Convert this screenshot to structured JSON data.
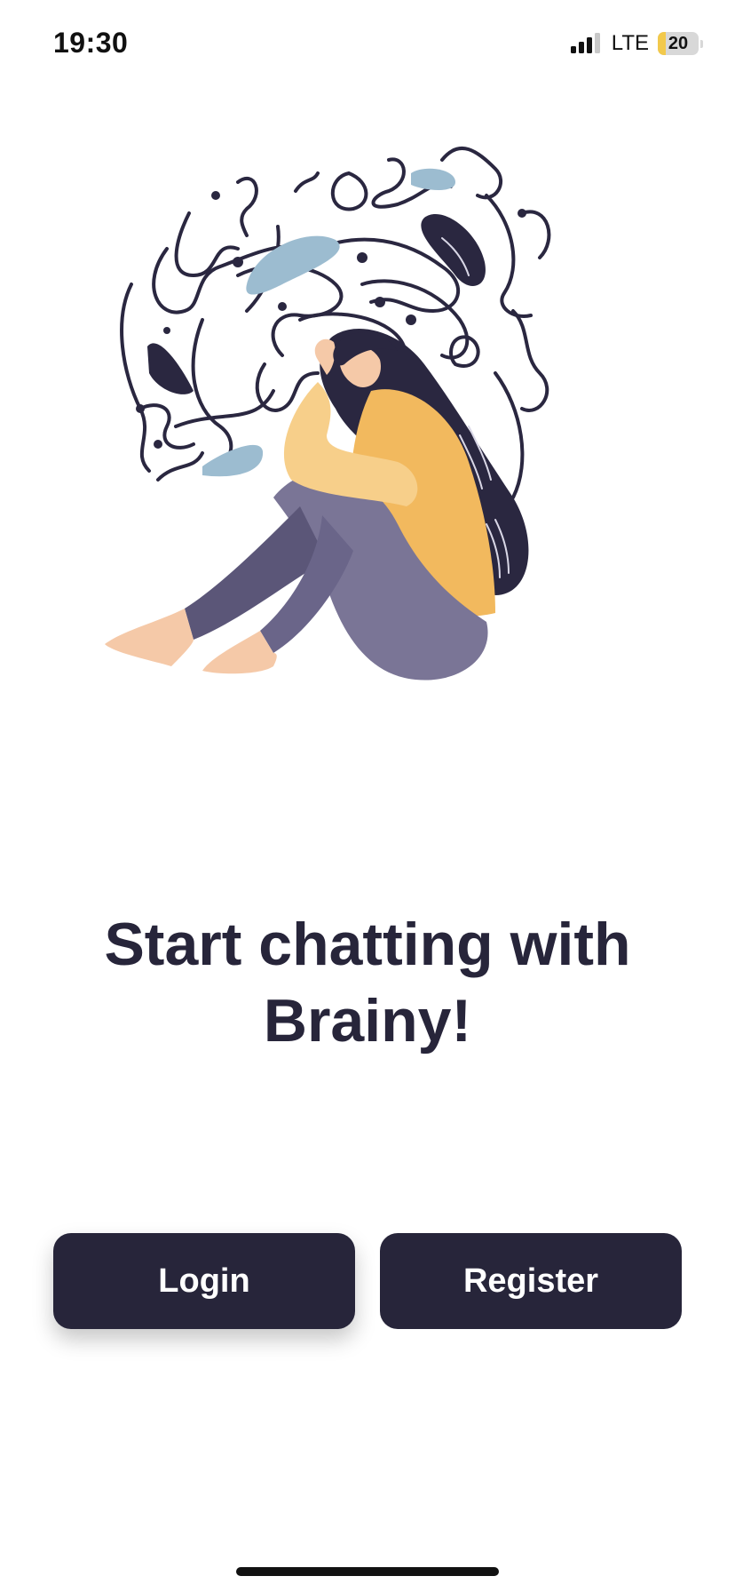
{
  "status_bar": {
    "time": "19:30",
    "network": "LTE",
    "battery_level": "20",
    "battery_fraction": 0.2,
    "signal_bars_active": 3,
    "signal_bars_total": 4
  },
  "illustration": {
    "icon": "stressed-woman-illustration"
  },
  "headline": "Start chatting with Brainy!",
  "buttons": {
    "login_label": "Login",
    "register_label": "Register"
  },
  "colors": {
    "primary": "#27253a",
    "background": "#ffffff",
    "accent_yellow": "#f2b95e",
    "accent_blue": "#9cbcd0",
    "accent_purple": "#6f6a8f"
  }
}
